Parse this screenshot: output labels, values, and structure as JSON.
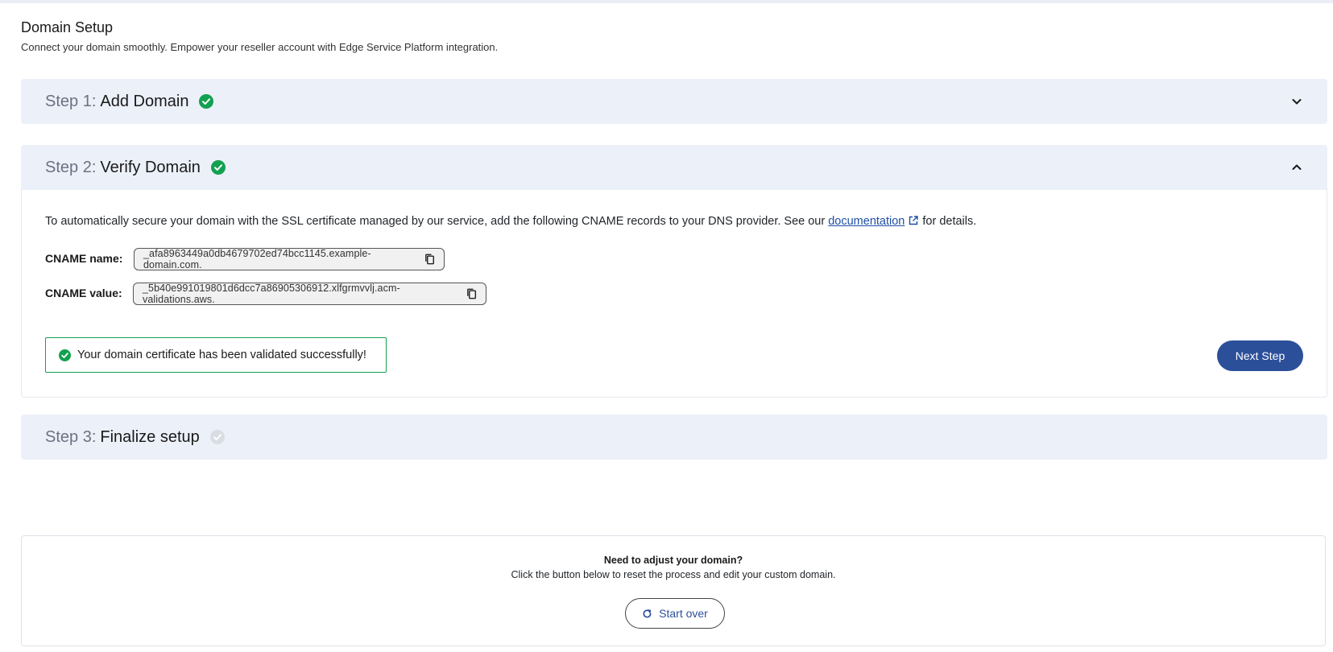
{
  "header": {
    "title": "Domain Setup",
    "subtitle": "Connect your domain smoothly. Empower your reseller account with Edge Service Platform integration."
  },
  "steps": [
    {
      "label": "Step 1:",
      "name": "Add Domain",
      "status": "complete",
      "expanded": false
    },
    {
      "label": "Step 2:",
      "name": "Verify Domain",
      "status": "complete",
      "expanded": true
    },
    {
      "label": "Step 3:",
      "name": "Finalize setup",
      "status": "pending",
      "expanded": false
    }
  ],
  "verify": {
    "intro_before": "To automatically secure your domain with the SSL certificate managed by our service, add the following CNAME records to your DNS provider. See our ",
    "doc_link": "documentation",
    "intro_after": " for details.",
    "cname_name_label": "CNAME name:",
    "cname_name_value": "_afa8963449a0db4679702ed74bcc1145.example-domain.com.",
    "cname_value_label": "CNAME value:",
    "cname_value_value": "_5b40e991019801d6dcc7a86905306912.xlfgrmvvlj.acm-validations.aws.",
    "success_message": "Your domain certificate has been validated successfully!",
    "next_button": "Next Step"
  },
  "adjust": {
    "title": "Need to adjust your domain?",
    "description": "Click the button below to reset the process and edit your custom domain.",
    "button": "Start over"
  },
  "colors": {
    "accent": "#2c4f9a",
    "success": "#12a150",
    "step_header_bg": "#ecf0f9",
    "link": "#1f4fa5"
  },
  "icons": {
    "check": "check-circle-icon",
    "chevron_down": "chevron-down-icon",
    "chevron_up": "chevron-up-icon",
    "copy": "copy-icon",
    "external": "external-link-icon",
    "refresh": "refresh-icon"
  }
}
